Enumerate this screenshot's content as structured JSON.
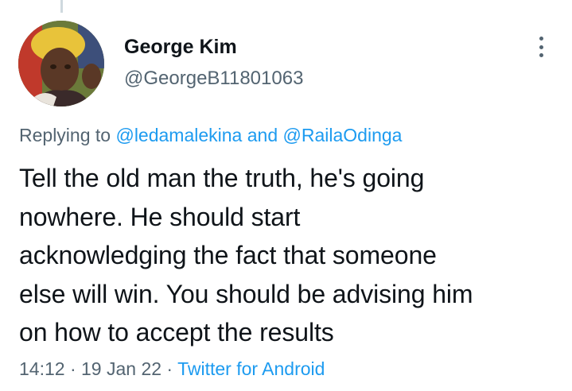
{
  "author": {
    "display_name": "George Kim",
    "handle": "@GeorgeB11801063"
  },
  "reply": {
    "prefix": "Replying to ",
    "mention1": "@ledamalekina",
    "connector": " and ",
    "mention2": "@RailaOdinga"
  },
  "tweet": {
    "lines": [
      "Tell the old man the truth, he's going",
      "nowhere. He should start",
      "acknowledging the fact that someone",
      "else will win. You should be advising him",
      "on how to accept the results"
    ]
  },
  "meta": {
    "time": "14:12",
    "sep1": " · ",
    "date": "19 Jan 22",
    "sep2": " · ",
    "source": "Twitter for Android"
  },
  "colors": {
    "link": "#1d9bf0",
    "secondary": "#536471",
    "text": "#0f1419"
  },
  "icons": {
    "more": "more-options-icon"
  }
}
